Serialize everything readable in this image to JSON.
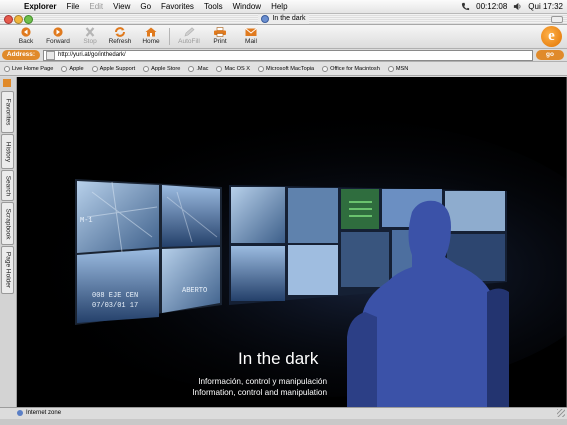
{
  "menubar": {
    "app_name": "Explorer",
    "menus": [
      "File",
      "Edit",
      "View",
      "Go",
      "Favorites",
      "Tools",
      "Window",
      "Help"
    ],
    "disabled_menus": [
      "Edit"
    ],
    "clock_primary": "00:12:08",
    "clock_secondary": "Qui 17:32"
  },
  "window": {
    "title": "In the dark"
  },
  "toolbar": {
    "back": "Back",
    "forward": "Forward",
    "stop": "Stop",
    "refresh": "Refresh",
    "home": "Home",
    "autofill": "AutoFill",
    "print": "Print",
    "mail": "Mail"
  },
  "address": {
    "label": "Address:",
    "url": "http://yuri.at/go/inthedark/",
    "go": "go"
  },
  "favorites": [
    "Live Home Page",
    "Apple",
    "Apple Support",
    "Apple Store",
    ".Mac",
    "Mac OS X",
    "Microsoft MacTopia",
    "Office for Macintosh",
    "MSN"
  ],
  "sidebar": {
    "tabs": [
      "Favorites",
      "History",
      "Search",
      "Scrapbook",
      "Page Holder"
    ]
  },
  "page": {
    "title": "In the dark",
    "subtitle_es": "Información, control y manipulación",
    "subtitle_en": "Information, control and manipulation",
    "monitor_caption_1": "M-1",
    "monitor_caption_2": "008 EJE CEN",
    "monitor_caption_3": "07/03/01 17",
    "monitor_caption_4": "ABERTO"
  },
  "status": {
    "zone": "Internet zone"
  },
  "colors": {
    "accent": "#e08a2a",
    "page_bg": "#000000",
    "monitor_tint": "#7fa6d4",
    "person_tint": "#3b52a8"
  }
}
